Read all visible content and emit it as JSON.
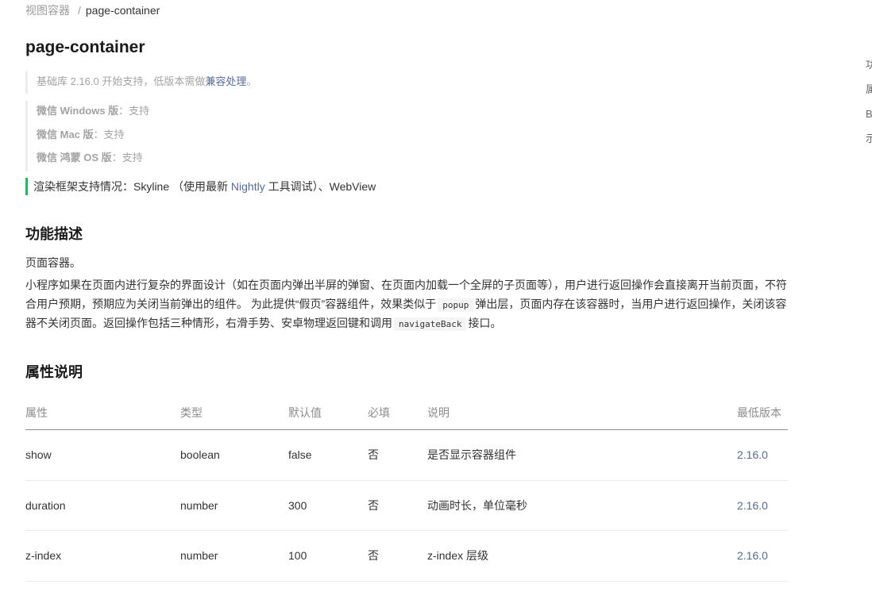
{
  "breadcrumb": {
    "parent": "视图容器",
    "separator": "/",
    "current": "page-container"
  },
  "title": "page-container",
  "since": {
    "text": "基础库 2.16.0 开始支持，低版本需做",
    "link": "兼容处理",
    "suffix": "。"
  },
  "platforms": [
    {
      "name": "微信 Windows 版",
      "value": "：支持"
    },
    {
      "name": "微信 Mac 版",
      "value": "：支持"
    },
    {
      "name": "微信 鸿蒙 OS 版",
      "value": "：支持"
    }
  ],
  "render_support": {
    "prefix": "渲染框架支持情况：Skyline （使用最新 ",
    "link": "Nightly",
    "suffix": " 工具调试）、WebView"
  },
  "sections": {
    "description_title": "功能描述",
    "attributes_title": "属性说明"
  },
  "description": {
    "short": "页面容器。",
    "long_part1": "小程序如果在页面内进行复杂的界面设计（如在页面内弹出半屏的弹窗、在页面内加载一个全屏的子页面等），用户进行返回操作会直接离开当前页面，不符合用户预期，预期应为关闭当前弹出的组件。 为此提供“假页”容器组件，效果类似于",
    "code1": "popup",
    "long_part2": "弹出层，页面内存在该容器时，当用户进行返回操作，关闭该容器不关闭页面。返回操作包括三种情形，右滑手势、安卓物理返回键和调用",
    "code2": "navigateBack",
    "long_part3": "接口。"
  },
  "table": {
    "headers": {
      "name": "属性",
      "type": "类型",
      "default": "默认值",
      "required": "必填",
      "desc": "说明",
      "version": "最低版本"
    },
    "rows": [
      {
        "name": "show",
        "type": "boolean",
        "default": "false",
        "required": "否",
        "desc": "是否显示容器组件",
        "version": "2.16.0"
      },
      {
        "name": "duration",
        "type": "number",
        "default": "300",
        "required": "否",
        "desc": "动画时长，单位毫秒",
        "version": "2.16.0"
      },
      {
        "name": "z-index",
        "type": "number",
        "default": "100",
        "required": "否",
        "desc": "z-index 层级",
        "version": "2.16.0"
      }
    ]
  },
  "side_toc": [
    "功",
    "属",
    "B",
    "示"
  ],
  "colors": {
    "link": "#576b95",
    "accent_green": "#07c160",
    "muted": "#a3a3a3"
  }
}
